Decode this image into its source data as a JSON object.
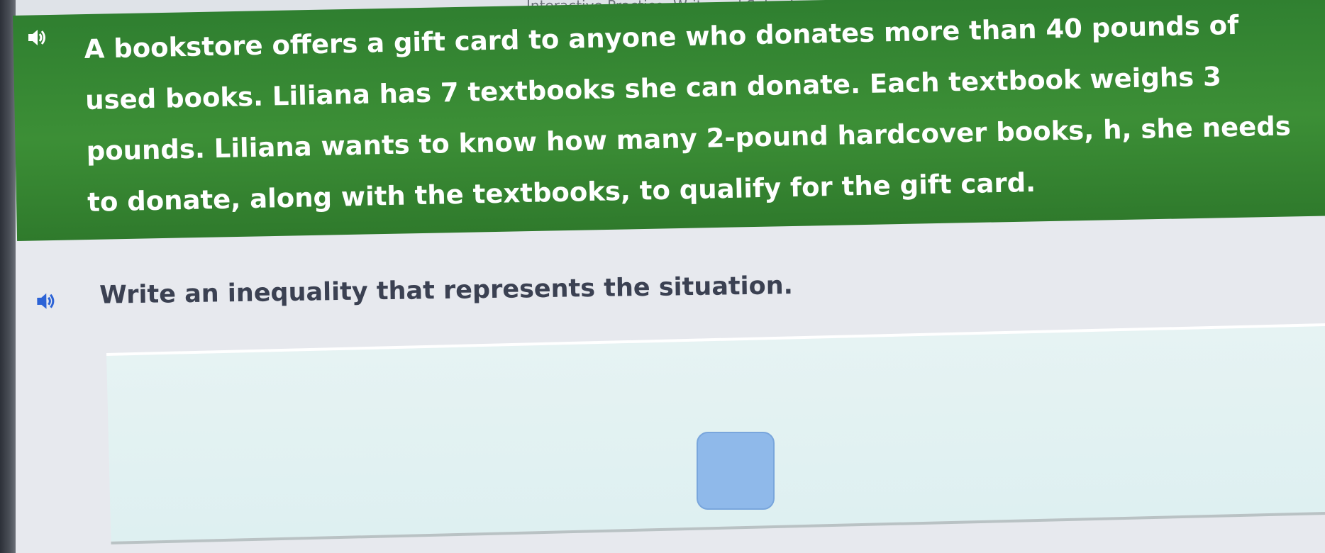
{
  "header": {
    "title": "Interactive Practice: Write and Solve Inequalities"
  },
  "question": {
    "audio_icon": "speaker-icon",
    "text": "A bookstore offers a gift card to anyone who donates more than 40 pounds of used books. Liliana has 7 textbooks she can donate. Each textbook weighs 3 pounds. Liliana wants to know how many 2-pound hardcover books, h, she needs to donate, along with the textbooks, to qualify for the gift card."
  },
  "subquestion": {
    "audio_icon": "speaker-icon",
    "text": "Write an inequality that represents the situation."
  },
  "answer": {
    "value": "",
    "placeholder": ""
  },
  "colors": {
    "banner_green": "#3c8f36",
    "answer_box": "#8fb9ea",
    "panel": "#e3f2f2"
  }
}
